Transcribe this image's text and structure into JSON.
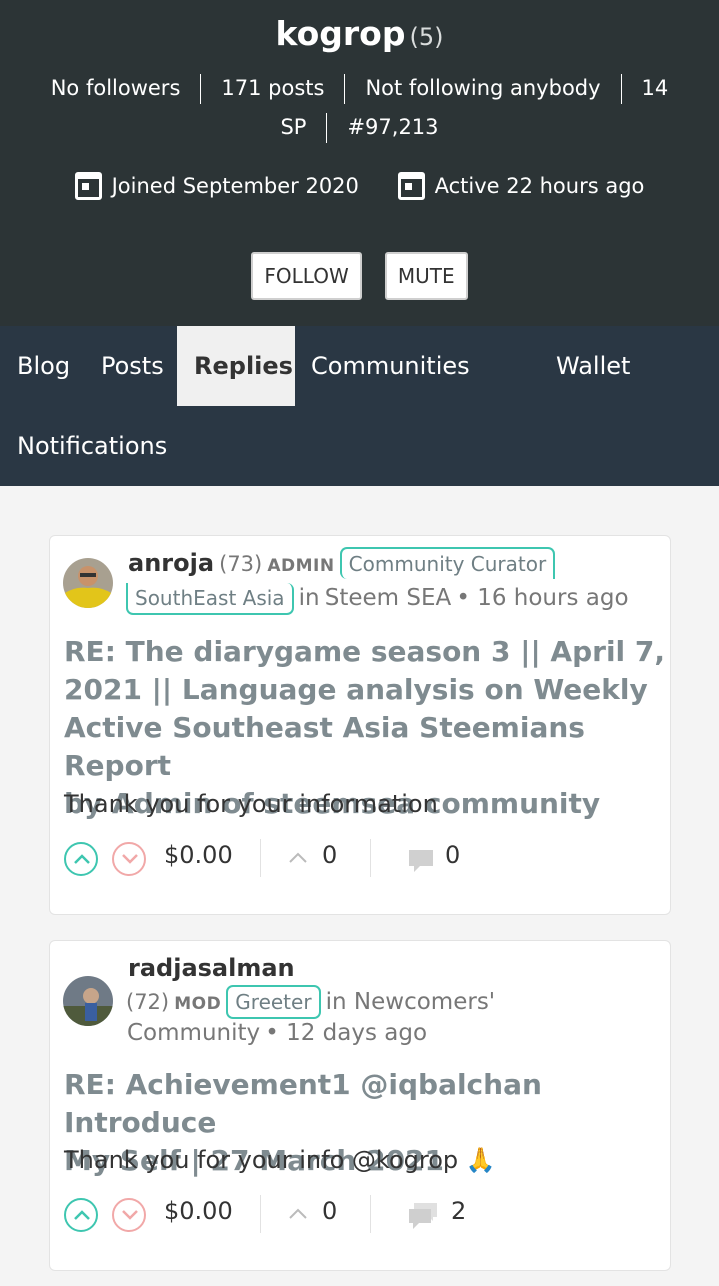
{
  "profile": {
    "name": "kogrop",
    "reputation": "(5)",
    "followers": "No followers",
    "posts": "171 posts",
    "following": "Not following anybody",
    "sp_num": "14",
    "sp_unit": "SP",
    "rank": "#97,213",
    "joined": "Joined September 2020",
    "active": "Active 22 hours ago",
    "follow_label": "FOLLOW",
    "mute_label": "MUTE"
  },
  "tabs": [
    "Blog",
    "Posts",
    "Replies",
    "Communities",
    "Wallet",
    "Notifications"
  ],
  "active_tab": "Replies",
  "colors": {
    "header_bg": "#2c3436",
    "tabs_bg": "#2a3744",
    "badge_border": "#3ec6b0",
    "downvote": "#f1a8a8"
  },
  "replies": [
    {
      "author": "anroja",
      "reputation": "(73)",
      "role": "ADMIN",
      "badge_line1": "Community Curator",
      "badge_line2": "SouthEast Asia",
      "community_prefix": "in",
      "community": "Steem SEA",
      "time": "• 16 hours ago",
      "title_lines": [
        "RE: The diarygame season 3 || April 7,",
        "2021 || Language analysis on Weekly",
        "Active Southeast Asia Steemians Report",
        "by Admin of steemsea community"
      ],
      "body": "Thank you for your information",
      "payout": "$0.00",
      "votes": "0",
      "comments": "0"
    },
    {
      "author": "radjasalman",
      "reputation": "(72)",
      "role": "MOD",
      "badge": "Greeter",
      "community_line1": "in Newcomers'",
      "community_line2": "Community",
      "time": "• 12 days ago",
      "title_lines": [
        "RE: Achievement1 @iqbalchan Introduce",
        "My Self | 27 March 2021"
      ],
      "body": "Thank you for your info @kogrop 🙏",
      "payout": "$0.00",
      "votes": "0",
      "comments": "2"
    }
  ]
}
